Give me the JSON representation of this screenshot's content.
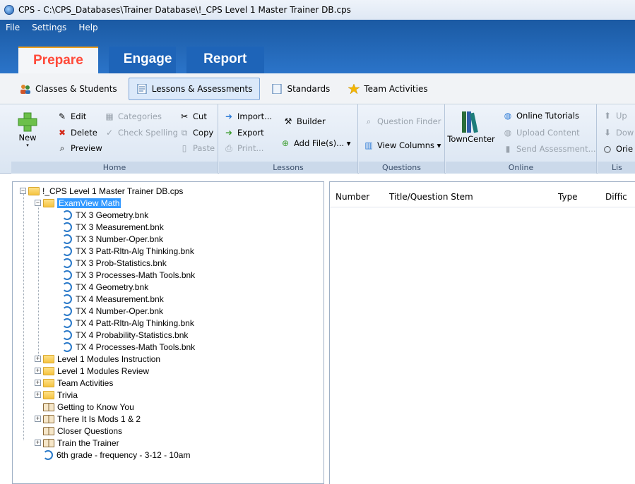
{
  "window": {
    "title": "CPS - C:\\CPS_Databases\\Trainer Database\\!_CPS Level 1 Master Trainer DB.cps"
  },
  "menu": [
    "File",
    "Settings",
    "Help"
  ],
  "main_tabs": {
    "prepare": "Prepare",
    "engage": "Engage",
    "report": "Report"
  },
  "sub_tabs": {
    "classes": "Classes & Students",
    "lessons": "Lessons & Assessments",
    "standards": "Standards",
    "team": "Team Activities"
  },
  "ribbon": {
    "home": {
      "label": "Home",
      "new": "New",
      "edit": "Edit",
      "delete": "Delete",
      "preview": "Preview",
      "categories": "Categories",
      "check_spelling": "Check Spelling",
      "cut": "Cut",
      "copy": "Copy",
      "paste": "Paste"
    },
    "lessons": {
      "label": "Lessons",
      "import": "Import...",
      "export": "Export",
      "print": "Print...",
      "builder": "Builder",
      "add_files": "Add File(s)...  ▾"
    },
    "questions": {
      "label": "Questions",
      "finder": "Question Finder",
      "view_columns": "View Columns  ▾"
    },
    "online": {
      "label": "Online",
      "towncenter": "TownCenter",
      "tutorials": "Online Tutorials",
      "upload": "Upload Content",
      "send": "Send Assessment..."
    },
    "list": {
      "label": "Lis",
      "up": "Up",
      "down": "Dow",
      "orient": "Orie"
    }
  },
  "columns": [
    "Number",
    "Title/Question Stem",
    "Type",
    "Diffic"
  ],
  "tree": {
    "root": "!_CPS Level 1 Master Trainer DB.cps",
    "examview": "ExamView Math",
    "bnk_files": [
      "TX 3 Geometry.bnk",
      "TX 3 Measurement.bnk",
      "TX 3 Number-Oper.bnk",
      "TX 3 Patt-Rltn-Alg Thinking.bnk",
      "TX 3 Prob-Statistics.bnk",
      "TX 3 Processes-Math Tools.bnk",
      "TX 4 Geometry.bnk",
      "TX 4 Measurement.bnk",
      "TX 4 Number-Oper.bnk",
      "TX 4 Patt-Rltn-Alg Thinking.bnk",
      "TX 4 Probability-Statistics.bnk",
      "TX 4 Processes-Math Tools.bnk"
    ],
    "folders": [
      "Level 1 Modules Instruction",
      "Level 1 Modules Review",
      "Team Activities",
      "Trivia"
    ],
    "getting": "Getting to Know You",
    "there": "There It Is Mods 1 & 2",
    "closer": "Closer Questions",
    "train": "Train the Trainer",
    "sixth": "6th grade - frequency - 3-12 - 10am"
  }
}
